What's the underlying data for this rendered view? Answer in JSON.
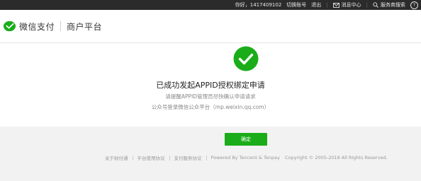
{
  "topbar": {
    "greeting": "你好，1417409102",
    "switch_account": "切换账号",
    "logout": "退出",
    "messages": "消息中心",
    "search": "服务商搜索",
    "help": "?"
  },
  "header": {
    "brand": "微信支付",
    "platform": "商户平台"
  },
  "result": {
    "title": "已成功发起APPID授权绑定申请",
    "line1": "请提醒APPID管理员尽快确认申请请求",
    "line2": "公众号登录微信公众平台（mp.weixin.qq.com）"
  },
  "actions": {
    "confirm_label": "确定"
  },
  "footer": {
    "links": [
      "关于财付通",
      "平台使用协议",
      "支付服务协议"
    ],
    "powered": "Powered By Tencent & Tenpay",
    "copyright": "Copyright © 2005-2018 All Rights Reserved."
  },
  "colors": {
    "accent_green": "#1aad19",
    "topbar_bg": "#2b2b2b"
  }
}
